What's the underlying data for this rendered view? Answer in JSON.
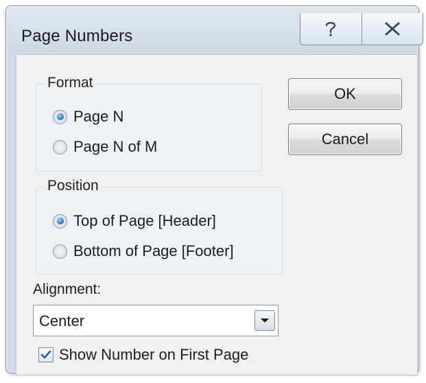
{
  "window": {
    "title": "Page Numbers",
    "help_icon": "question-mark",
    "close_icon": "x"
  },
  "format": {
    "label": "Format",
    "options": [
      {
        "label": "Page N",
        "selected": true
      },
      {
        "label": "Page N of M",
        "selected": false
      }
    ]
  },
  "position": {
    "label": "Position",
    "options": [
      {
        "label": "Top of Page [Header]",
        "selected": true
      },
      {
        "label": "Bottom of Page [Footer]",
        "selected": false
      }
    ]
  },
  "alignment": {
    "label": "Alignment:",
    "value": "Center"
  },
  "show_first_page": {
    "label": "Show Number on First Page",
    "checked": true
  },
  "buttons": {
    "ok": "OK",
    "cancel": "Cancel"
  },
  "colors": {
    "accent": "#2a7bd5",
    "frame": "#cfdae6"
  }
}
